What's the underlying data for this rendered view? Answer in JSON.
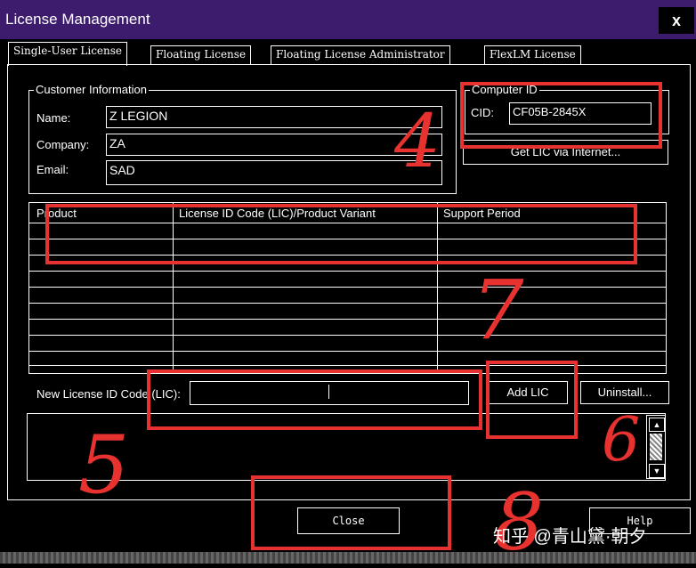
{
  "window": {
    "title": "License Management",
    "close_label": "x"
  },
  "tabs": [
    {
      "label": "Single-User License",
      "active": true
    },
    {
      "label": "Floating License",
      "active": false
    },
    {
      "label": "Floating License Administrator",
      "active": false
    },
    {
      "label": "FlexLM License",
      "active": false
    }
  ],
  "customer": {
    "legend": "Customer Information",
    "name_label": "Name:",
    "name_value": "Z LEGION",
    "company_label": "Company:",
    "company_value": "ZA",
    "email_label": "Email:",
    "email_value": "SAD"
  },
  "computer": {
    "legend": "Computer ID",
    "cid_label": "CID:",
    "cid_value": "CF05B-2845X",
    "get_lic_button": "Get LIC via Internet..."
  },
  "table": {
    "columns": [
      "Product",
      "License ID Code (LIC)/Product Variant",
      "Support Period"
    ]
  },
  "new_lic": {
    "label": "New License ID Code (LIC):",
    "value": ""
  },
  "buttons": {
    "add_lic": "Add LIC",
    "uninstall": "Uninstall...",
    "close": "Close",
    "help": "Help"
  },
  "annotations": {
    "a4": "4",
    "a5": "5",
    "a6": "6",
    "a7": "7",
    "a8": "8"
  },
  "watermark": "知乎 @青山黛·朝夕",
  "colors": {
    "title_bar": "#3d1c6e",
    "annotation_red": "#e8322f",
    "background": "#000000"
  }
}
